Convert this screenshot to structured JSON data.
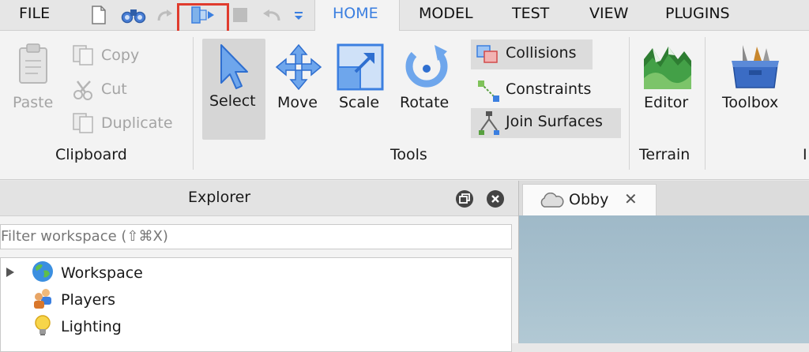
{
  "menu": {
    "file": "FILE",
    "tabs": [
      "HOME",
      "MODEL",
      "TEST",
      "VIEW",
      "PLUGINS"
    ],
    "active_tab": "HOME"
  },
  "quick_access": {
    "icons": [
      "new-file-icon",
      "binoculars-icon",
      "redo-icon",
      "play-here-icon",
      "stop-icon",
      "undo-icon",
      "customize-dropdown-icon"
    ],
    "highlighted": "play-here-icon"
  },
  "ribbon": {
    "clipboard": {
      "title": "Clipboard",
      "paste": "Paste",
      "copy": "Copy",
      "cut": "Cut",
      "duplicate": "Duplicate"
    },
    "tools": {
      "title": "Tools",
      "select": "Select",
      "move": "Move",
      "scale": "Scale",
      "rotate": "Rotate",
      "collisions": "Collisions",
      "constraints": "Constraints",
      "join_surfaces": "Join Surfaces"
    },
    "terrain": {
      "title": "Terrain",
      "editor": "Editor"
    },
    "toolbox": {
      "label": "Toolbox",
      "partial_title": "I"
    }
  },
  "explorer": {
    "title": "Explorer",
    "filter_placeholder": "Filter workspace (⇧⌘X)",
    "items": [
      {
        "label": "Workspace",
        "icon": "globe-icon",
        "expandable": true
      },
      {
        "label": "Players",
        "icon": "players-icon",
        "expandable": false
      },
      {
        "label": "Lighting",
        "icon": "lightbulb-icon",
        "expandable": false
      }
    ]
  },
  "viewport": {
    "tab_label": "Obby",
    "tab_icon": "cloud-icon"
  },
  "colors": {
    "accent": "#3b7fe0",
    "highlight": "#e03c2e",
    "ribbon_bg": "#f3f3f3",
    "menubar_bg": "#e6e6e6",
    "sky": "#a9c2cf"
  }
}
